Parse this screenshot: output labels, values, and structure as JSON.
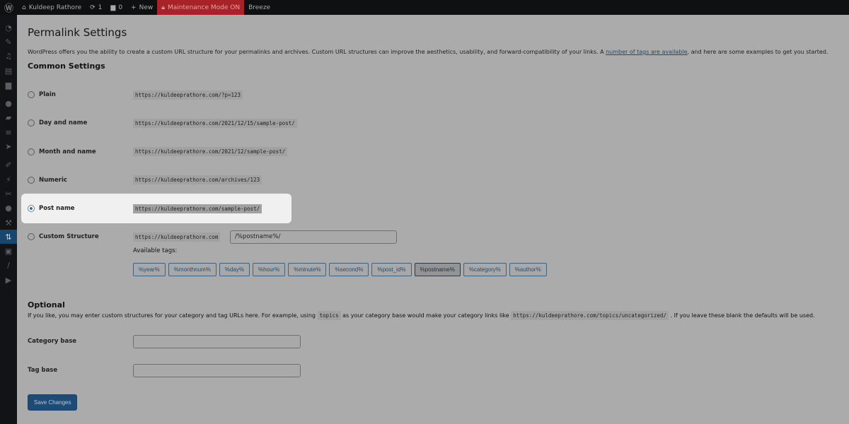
{
  "topbar": {
    "site": "Kuldeep Rathore",
    "updates": "1",
    "comments": "0",
    "new": "New",
    "maintenance": "Maintenance Mode ON",
    "breeze": "Breeze"
  },
  "sidebar": {
    "icons": [
      "dashboard-icon",
      "pin-icon",
      "media-icon",
      "pages-icon",
      "comments-icon",
      "elementor-icon",
      "folder-icon",
      "templates-icon",
      "plane-icon",
      "appearance-icon",
      "plugins-icon",
      "scissors-icon",
      "users-icon",
      "tools-icon",
      "settings-icon",
      "vault-icon",
      "brush-icon",
      "play-icon"
    ],
    "active_index": 14
  },
  "page": {
    "title": "Permalink Settings",
    "intro_before": "WordPress offers you the ability to create a custom URL structure for your permalinks and archives. Custom URL structures can improve the aesthetics, usability, and forward-compatibility of your links. A ",
    "intro_link": "number of tags are available",
    "intro_after": ", and here are some examples to get you started.",
    "common_heading": "Common Settings",
    "options": [
      {
        "label": "Plain",
        "url": "https://kuldeeprathore.com/?p=123",
        "selected": false
      },
      {
        "label": "Day and name",
        "url": "https://kuldeeprathore.com/2021/12/15/sample-post/",
        "selected": false
      },
      {
        "label": "Month and name",
        "url": "https://kuldeeprathore.com/2021/12/sample-post/",
        "selected": false
      },
      {
        "label": "Numeric",
        "url": "https://kuldeeprathore.com/archives/123",
        "selected": false
      },
      {
        "label": "Post name",
        "url": "https://kuldeeprathore.com/sample-post/",
        "selected": true
      }
    ],
    "custom": {
      "label": "Custom Structure",
      "prefix": "https://kuldeeprathore.com",
      "value": "/%postname%/",
      "available_tags": "Available tags:",
      "tags": [
        "%year%",
        "%monthnum%",
        "%day%",
        "%hour%",
        "%minute%",
        "%second%",
        "%post_id%",
        "%postname%",
        "%category%",
        "%author%"
      ],
      "pressed": "%postname%"
    },
    "optional_heading": "Optional",
    "optional_before": "If you like, you may enter custom structures for your category and tag URLs here. For example, using ",
    "optional_code1": "topics",
    "optional_mid": " as your category base would make your category links like ",
    "optional_code2": "https://kuldeeprathore.com/topics/uncategorized/",
    "optional_after": " . If you leave these blank the defaults will be used.",
    "category_base": {
      "label": "Category base",
      "value": ""
    },
    "tag_base": {
      "label": "Tag base",
      "value": ""
    },
    "save": "Save Changes"
  }
}
